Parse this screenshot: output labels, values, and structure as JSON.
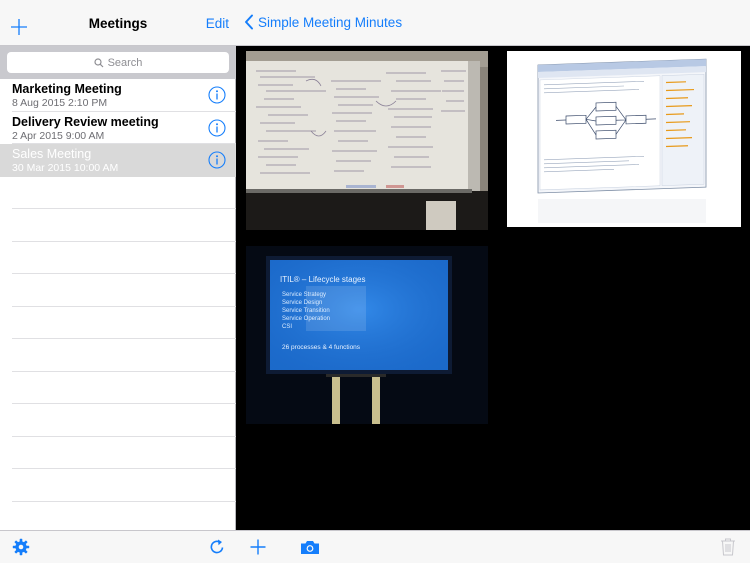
{
  "colors": {
    "accent": "#157efb",
    "selected_row": "#d9d9d9",
    "detail_background": "#000000"
  },
  "master": {
    "title": "Meetings",
    "add_icon": "plus-icon",
    "edit_label": "Edit",
    "search_placeholder": "Search",
    "meetings": [
      {
        "title": "Marketing Meeting",
        "date": "8 Aug 2015 2:10 PM",
        "selected": false
      },
      {
        "title": "Delivery Review meeting",
        "date": "2 Apr 2015 9:00 AM",
        "selected": false
      },
      {
        "title": "Sales Meeting",
        "date": "30 Mar 2015 10:00 AM",
        "selected": true
      }
    ],
    "toolbar": {
      "left_icon": "gear-icon",
      "right_icon": "refresh-icon"
    }
  },
  "detail": {
    "back_label": "Simple Meeting Minutes",
    "photos": [
      {
        "name": "whiteboard-photo"
      },
      {
        "name": "software-screenshot-photo"
      },
      {
        "name": "presentation-screen-photo",
        "text": {
          "heading": "ITIL® – Lifecycle stages",
          "lines": [
            "Service Strategy",
            "Service Design",
            "Service Transition",
            "Service Operation",
            "CSI"
          ],
          "footer": "26 processes & 4 functions"
        }
      }
    ],
    "toolbar": {
      "left_icon": "plus-icon",
      "camera_icon": "camera-icon",
      "trash_icon": "trash-icon"
    }
  }
}
